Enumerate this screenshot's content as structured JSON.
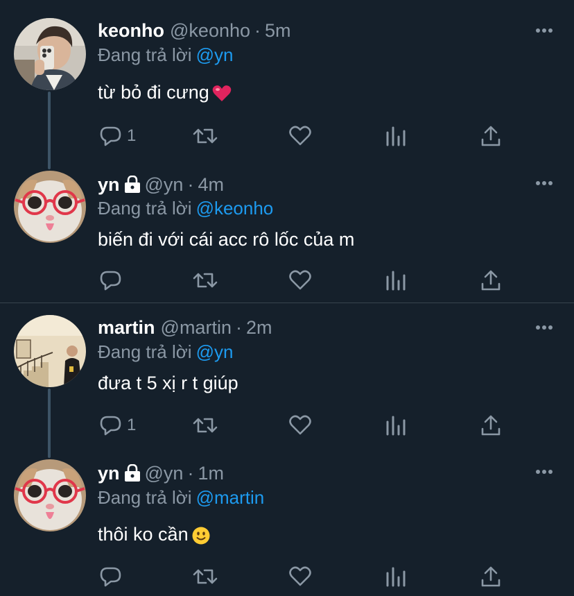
{
  "reply_prefix": "Đang trả lời",
  "colors": {
    "background": "#15202b",
    "text_secondary": "#8b98a5",
    "mention": "#1d9bf0",
    "thread_line": "#3d5466",
    "divider": "#38444d"
  },
  "tweets": [
    {
      "display_name": "keonho",
      "handle": "@keonho",
      "separator": "·",
      "time": "5m",
      "protected": false,
      "replying_to": "@yn",
      "text": "từ bỏ đi cưng",
      "emoji": "heart-emoji",
      "reply_count": "1",
      "avatar": "man-selfie-avatar"
    },
    {
      "display_name": "yn",
      "handle": "@yn",
      "separator": "·",
      "time": "4m",
      "protected": true,
      "replying_to": "@keonho",
      "text": "biến đi với cái acc rô lốc của m",
      "emoji": "",
      "reply_count": "",
      "avatar": "cat-with-glasses-avatar"
    },
    {
      "display_name": "martin",
      "handle": "@martin",
      "separator": "·",
      "time": "2m",
      "protected": false,
      "replying_to": "@yn",
      "text": "đưa t 5 xị r t giúp",
      "emoji": "",
      "reply_count": "1",
      "avatar": "person-on-stairs-avatar"
    },
    {
      "display_name": "yn",
      "handle": "@yn",
      "separator": "·",
      "time": "1m",
      "protected": true,
      "replying_to": "@martin",
      "text": "thôi ko cần",
      "emoji": "slight-smile-emoji",
      "reply_count": "",
      "avatar": "cat-with-glasses-avatar"
    }
  ],
  "icons": {
    "reply": "reply-icon",
    "retweet": "retweet-icon",
    "like": "like-icon",
    "analytics": "analytics-icon",
    "share": "share-icon",
    "more": "more-icon",
    "lock": "lock-icon"
  }
}
